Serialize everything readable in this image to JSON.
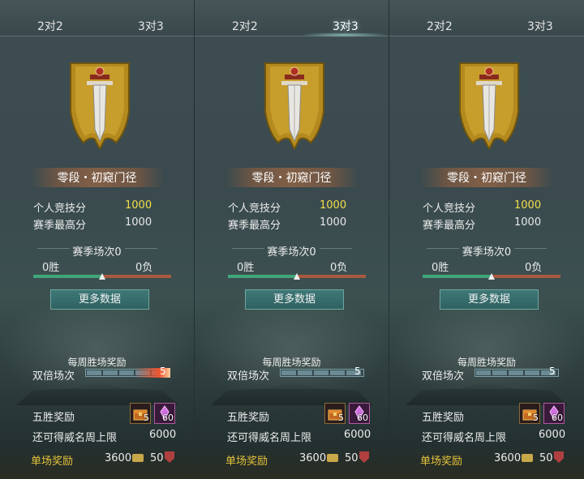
{
  "panels": [
    {
      "tabs": {
        "tab1": "2对2",
        "tab2": "3对3"
      },
      "active_tab": 0,
      "rank_name": "零段・初窥门径",
      "personal_score_label": "个人竞技分",
      "personal_score_value": "1000",
      "season_high_label": "赛季最高分",
      "season_high_value": "1000",
      "season_matches": "赛季场次0",
      "wins": "0胜",
      "losses": "0负",
      "win_ratio": 0.5,
      "more_data_button": "更多数据",
      "weekly_reward_title": "每周胜场奖励",
      "double_label": "双倍场次",
      "double_count": "5",
      "double_fire": true,
      "five_win_label": "五胜奖励",
      "reward_item1_count": "5",
      "reward_item2_count": "60",
      "weekly_cap_label": "还可得威名周上限",
      "weekly_cap_value": "6000",
      "single_reward_label": "单场奖励",
      "single_gold_value": "3600",
      "single_red_value": "50"
    },
    {
      "tabs": {
        "tab1": "2对2",
        "tab2": "3对3"
      },
      "active_tab": 1,
      "rank_name": "零段・初窥门径",
      "personal_score_label": "个人竞技分",
      "personal_score_value": "1000",
      "season_high_label": "赛季最高分",
      "season_high_value": "1000",
      "season_matches": "赛季场次0",
      "wins": "0胜",
      "losses": "0负",
      "win_ratio": 0.5,
      "more_data_button": "更多数据",
      "weekly_reward_title": "每周胜场奖励",
      "double_label": "双倍场次",
      "double_count": "5",
      "double_fire": false,
      "five_win_label": "五胜奖励",
      "reward_item1_count": "5",
      "reward_item2_count": "60",
      "weekly_cap_label": "还可得威名周上限",
      "weekly_cap_value": "6000",
      "single_reward_label": "单场奖励",
      "single_gold_value": "3600",
      "single_red_value": "50"
    },
    {
      "tabs": {
        "tab1": "2对2",
        "tab2": "3对3"
      },
      "active_tab": 0,
      "rank_name": "零段・初窥门径",
      "personal_score_label": "个人竞技分",
      "personal_score_value": "1000",
      "season_high_label": "赛季最高分",
      "season_high_value": "1000",
      "season_matches": "赛季场次0",
      "wins": "0胜",
      "losses": "0负",
      "win_ratio": 0.5,
      "more_data_button": "更多数据",
      "weekly_reward_title": "每周胜场奖励",
      "double_label": "双倍场次",
      "double_count": "5",
      "double_fire": false,
      "five_win_label": "五胜奖励",
      "reward_item1_count": "5",
      "reward_item2_count": "60",
      "weekly_cap_label": "还可得威名周上限",
      "weekly_cap_value": "6000",
      "single_reward_label": "单场奖励",
      "single_gold_value": "3600",
      "single_red_value": "50"
    }
  ],
  "colors": {
    "score_gold": "#f2df4a",
    "button_teal": "#3f7878",
    "win_green": "#3fa67a",
    "loss_red": "#a85a3e",
    "reward_label_yellow": "#e4c23a"
  },
  "icons": [
    "sword-banner-emblem-icon",
    "treasure-chest-icon",
    "purple-crystal-icon",
    "gold-ingot-icon",
    "red-shield-icon"
  ]
}
